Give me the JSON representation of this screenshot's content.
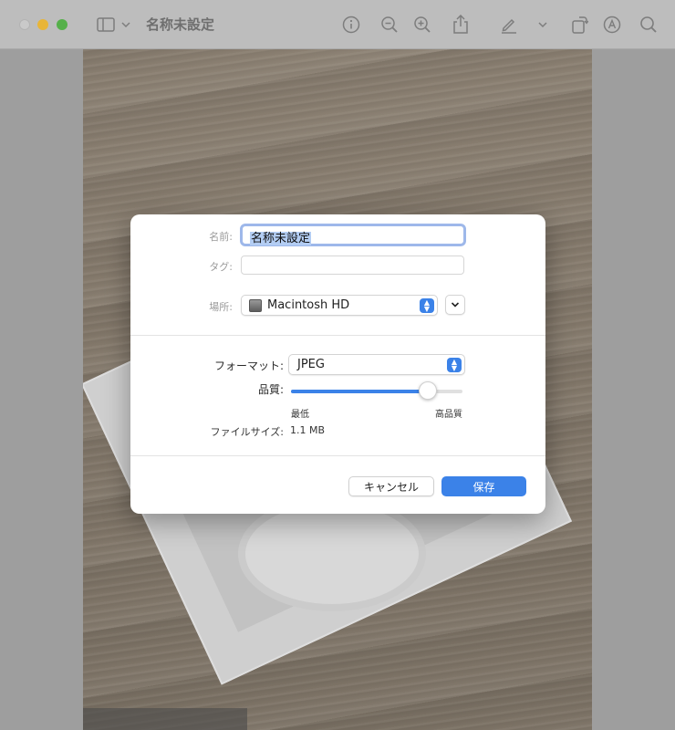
{
  "window": {
    "title": "名称未設定"
  },
  "toolbar": {
    "icons": [
      "sidebar-icon",
      "chevron-down-icon",
      "info-icon",
      "zoom-out-icon",
      "zoom-in-icon",
      "share-icon",
      "markup-pen-icon",
      "chevron-down-icon",
      "rotate-icon",
      "annotate-icon",
      "search-icon"
    ]
  },
  "dialog": {
    "name_label": "名前:",
    "name_value": "名称未設定",
    "tag_label": "タグ:",
    "tag_value": "",
    "location_label": "場所:",
    "location_value": "Macintosh HD",
    "format_label": "フォーマット:",
    "format_value": "JPEG",
    "quality_label": "品質:",
    "quality_level": 0.8,
    "quality_min_label": "最低",
    "quality_max_label": "高品質",
    "filesize_label": "ファイルサイズ:",
    "filesize_value": "1.1 MB",
    "cancel_label": "キャンセル",
    "save_label": "保存"
  },
  "colors": {
    "accent": "#3b82e8",
    "selection": "#b3cdf3"
  }
}
